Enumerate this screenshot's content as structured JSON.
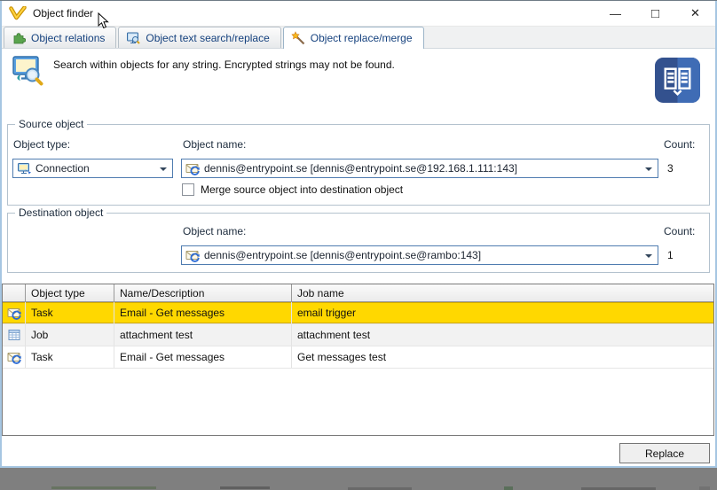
{
  "window": {
    "title": "Object finder",
    "minimize_glyph": "—",
    "maximize_glyph": "□",
    "close_glyph": "✕"
  },
  "tabs": [
    {
      "label": "Object relations",
      "icon": "puzzle-icon"
    },
    {
      "label": "Object text search/replace",
      "icon": "monitor-search-icon"
    },
    {
      "label": "Object replace/merge",
      "icon": "wand-icon"
    }
  ],
  "info": {
    "text": "Search within objects for any string. Encrypted strings may not be found."
  },
  "source": {
    "legend": "Source object",
    "object_type_label": "Object type:",
    "object_type_value": "Connection",
    "object_name_label": "Object name:",
    "object_name_value": "dennis@entrypoint.se [dennis@entrypoint.se@192.168.1.111:143]",
    "count_label": "Count:",
    "count_value": "3",
    "merge_label": "Merge source object into destination object"
  },
  "destination": {
    "legend": "Destination object",
    "object_name_label": "Object name:",
    "object_name_value": "dennis@entrypoint.se [dennis@entrypoint.se@rambo:143]",
    "count_label": "Count:",
    "count_value": "1"
  },
  "table": {
    "columns": [
      "",
      "Object type",
      "Name/Description",
      "Job name"
    ],
    "rows": [
      {
        "type": "Task",
        "name": "Email - Get messages",
        "job": "email trigger",
        "icon": "mail-task-icon",
        "selected": true
      },
      {
        "type": "Job",
        "name": "attachment test",
        "job": "attachment test",
        "icon": "job-icon",
        "selected": false
      },
      {
        "type": "Task",
        "name": "Email - Get messages",
        "job": "Get messages test",
        "icon": "mail-task-icon",
        "selected": false
      }
    ]
  },
  "footer": {
    "replace_label": "Replace"
  },
  "colors": {
    "selection_yellow": "#ffd800",
    "combo_border": "#4f7cb0",
    "tab_text": "#15417e",
    "book_blue": "#3f6ab2"
  }
}
